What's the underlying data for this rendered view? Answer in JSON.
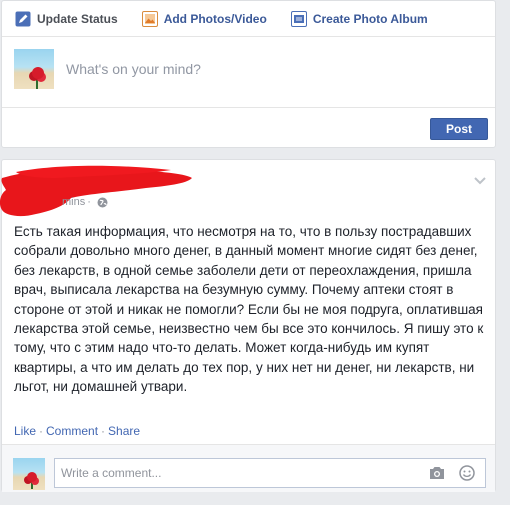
{
  "composer": {
    "tabs": [
      {
        "label": "Update Status",
        "icon": "pencil-icon"
      },
      {
        "label": "Add Photos/Video",
        "icon": "photo-icon"
      },
      {
        "label": "Create Photo Album",
        "icon": "album-icon"
      }
    ],
    "placeholder": "What's on your mind?",
    "post_label": "Post"
  },
  "post": {
    "timestamp": "mins",
    "privacy_icon": "globe-icon",
    "text": "Есть такая информация, что несмотря на то, что в пользу пострадавших собрали довольно много денег, в данный момент многие сидят без денег, без лекарств, в одной семье заболели дети от переохлаждения, пришла врач, выписала лекарства на безумную сумму. Почему аптеки стоят в стороне от этой и никак не помогли? Если бы не моя подруга, оплатившая лекарства этой семье, неизвестно чем бы все это кончилось. Я пишу это к тому, что с этим надо что-то делать. Может когда-нибудь им купят квартиры, а что им делать до тех пор, у них нет ни денег, ни лекарств, ни льгот, ни домашней утвари.",
    "actions": {
      "like": "Like",
      "comment": "Comment",
      "share": "Share",
      "separator": "·"
    },
    "comment_placeholder": "Write a comment..."
  },
  "colors": {
    "link": "#4267b2",
    "post_button": "#4267b2",
    "redaction": "#e8161b",
    "background": "#e9ebee"
  }
}
